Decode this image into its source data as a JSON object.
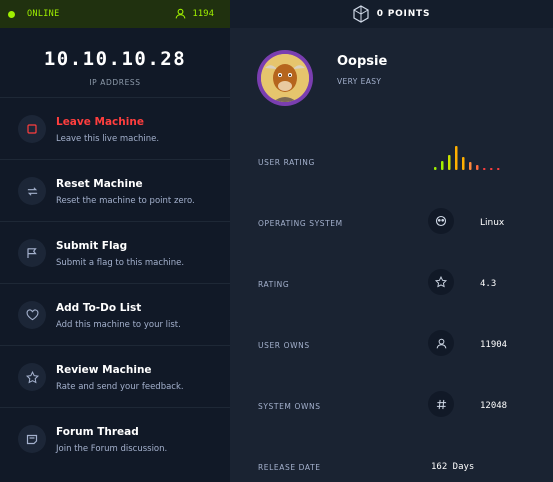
{
  "status": {
    "label": "ONLINE",
    "players": "1194"
  },
  "points": {
    "label": "0 POINTS"
  },
  "machine": {
    "ip": "10.10.10.28",
    "ip_label": "IP ADDRESS",
    "name": "Oopsie",
    "difficulty": "VERY EASY"
  },
  "actions": [
    {
      "title": "Leave Machine",
      "desc": "Leave this live machine.",
      "icon": "stop-icon"
    },
    {
      "title": "Reset Machine",
      "desc": "Reset the machine to point zero.",
      "icon": "reset-icon"
    },
    {
      "title": "Submit Flag",
      "desc": "Submit a flag to this machine.",
      "icon": "flag-icon"
    },
    {
      "title": "Add To-Do List",
      "desc": "Add this machine to your list.",
      "icon": "heart-icon"
    },
    {
      "title": "Review Machine",
      "desc": "Rate and send your feedback.",
      "icon": "star-icon"
    },
    {
      "title": "Forum Thread",
      "desc": "Join the Forum discussion.",
      "icon": "forum-icon"
    }
  ],
  "stats": {
    "user_rating": {
      "label": "USER RATING"
    },
    "os": {
      "label": "OPERATING SYSTEM",
      "value": "Linux",
      "icon": "linux-icon"
    },
    "rating": {
      "label": "RATING",
      "value": "4.3",
      "icon": "star-icon"
    },
    "user_owns": {
      "label": "USER OWNS",
      "value": "11904",
      "icon": "user-icon"
    },
    "system_owns": {
      "label": "SYSTEM OWNS",
      "value": "12048",
      "icon": "hash-icon"
    },
    "release_date": {
      "label": "RELEASE DATE",
      "value": "162 Days"
    }
  },
  "colors": {
    "accent_green": "#9fef00",
    "danger_red": "#ff3e3e",
    "rating_bar_colors": [
      "#9fef00",
      "#9fef00",
      "#c7e100",
      "#ffaf00",
      "#ffaf00",
      "#ff8a3d",
      "#ff6a3d",
      "#ff3e3e",
      "#ff3e3e",
      "#ff3e3e"
    ]
  }
}
